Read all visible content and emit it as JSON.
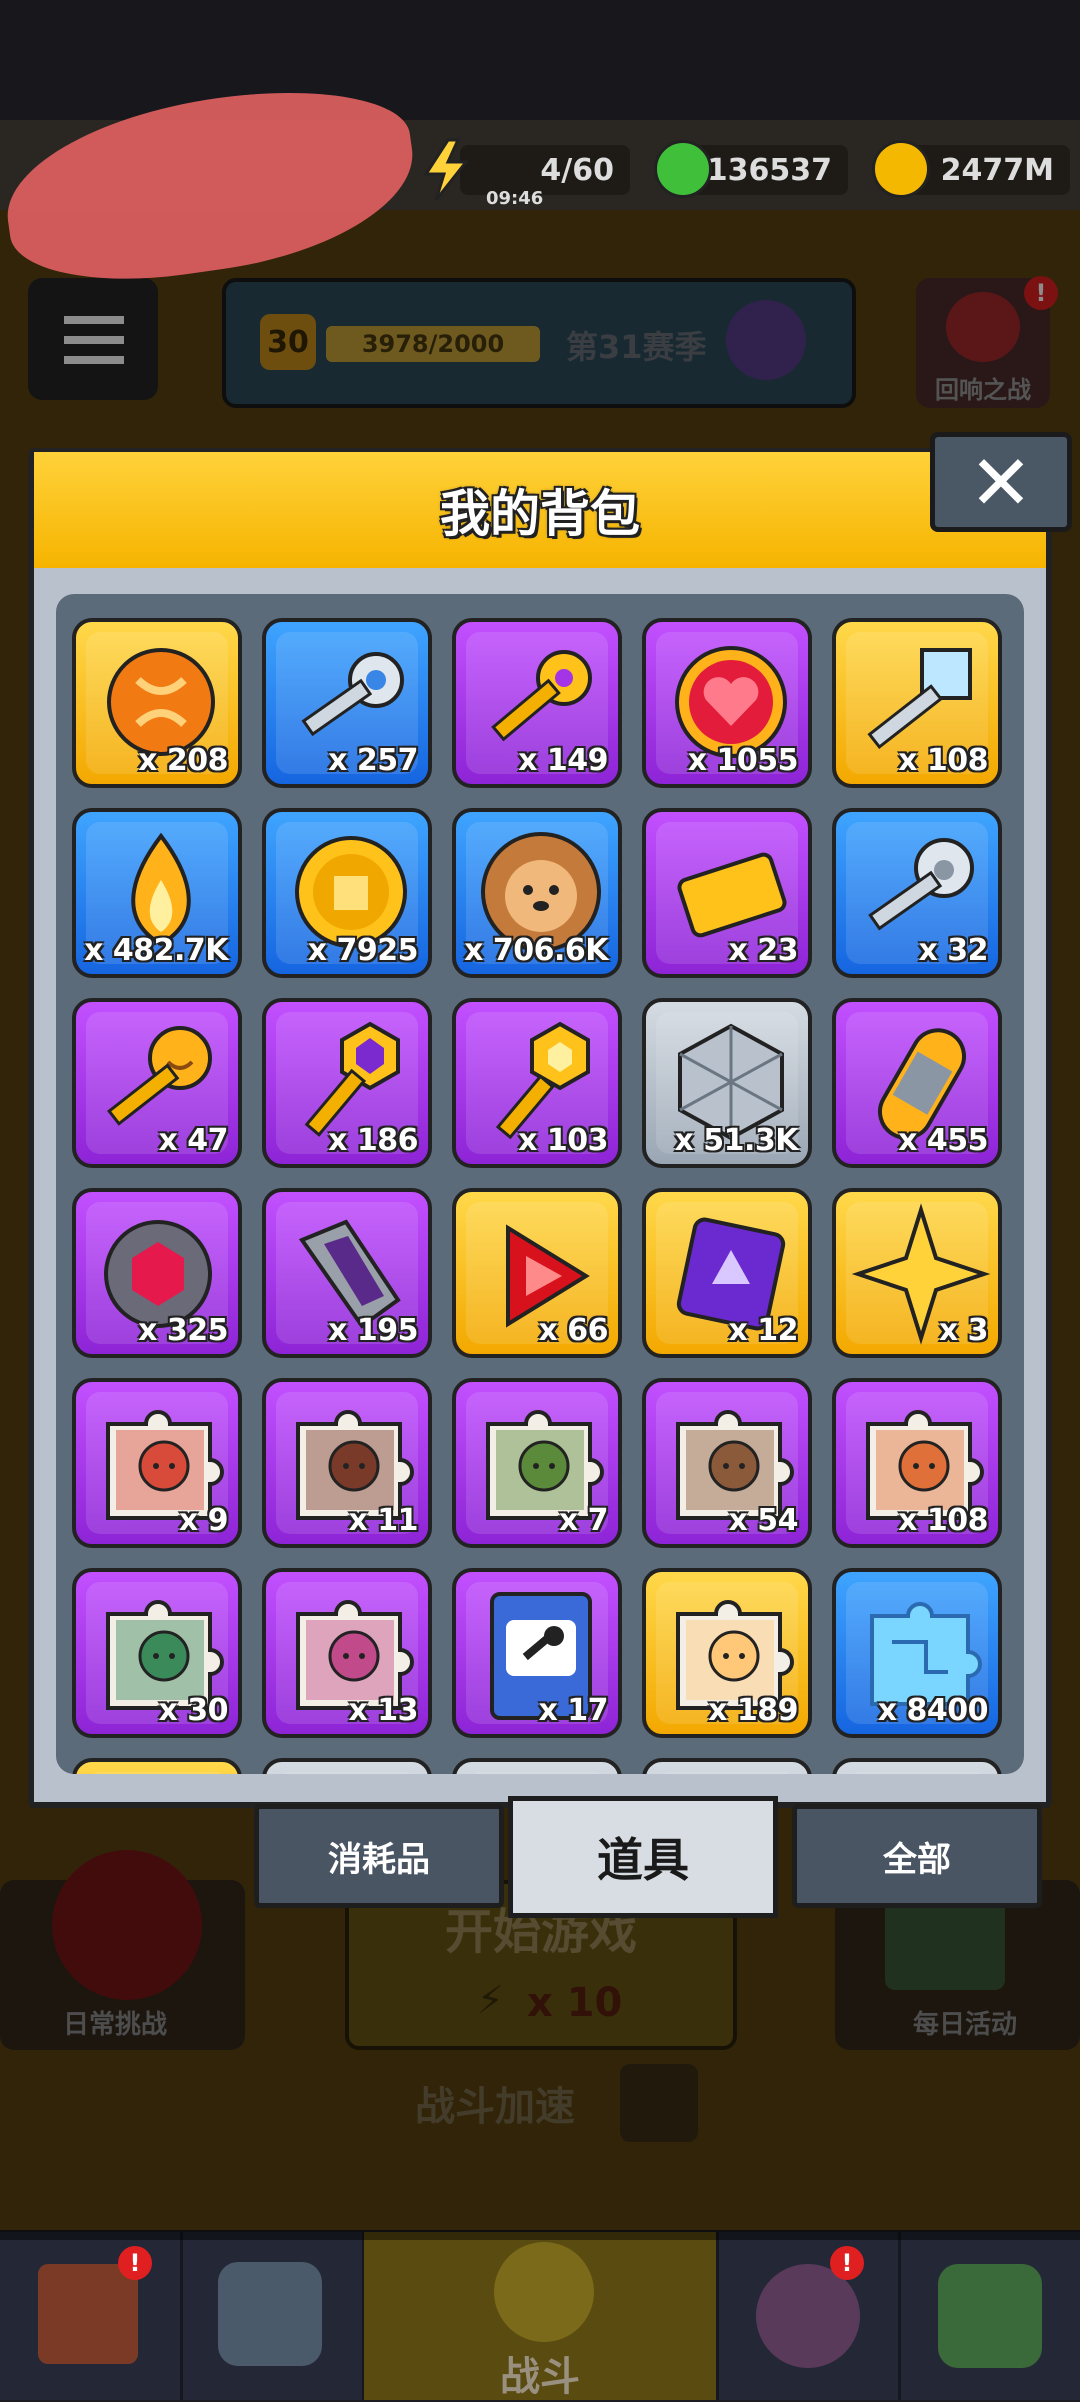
{
  "hud": {
    "energy": "4/60",
    "energy_timer": "09:46",
    "gems": "136537",
    "coins": "2477M"
  },
  "season": {
    "level": "30",
    "xp": "3978/2000",
    "title": "第31赛季"
  },
  "top_right_button": "回响之战",
  "side_left_label": "日常挑战",
  "side_right_label": "每日活动",
  "start_button": {
    "label": "开始游戏",
    "cost": "x 10"
  },
  "speed_label": "战斗加速",
  "nav_center_label": "战斗",
  "modal": {
    "title": "我的背包",
    "close_symbol": "✕",
    "tabs": [
      {
        "label": "消耗品"
      },
      {
        "label": "道具"
      },
      {
        "label": "全部"
      }
    ],
    "items": [
      {
        "icon": "orange-rune-coin-icon",
        "rarity": "gold",
        "count": "x 208"
      },
      {
        "icon": "silver-key-icon",
        "rarity": "blue",
        "count": "x 257"
      },
      {
        "icon": "golden-key-icon",
        "rarity": "purple",
        "count": "x 149"
      },
      {
        "icon": "heart-coin-icon",
        "rarity": "purple",
        "count": "x 1055"
      },
      {
        "icon": "crystal-key-icon",
        "rarity": "gold",
        "count": "x 108"
      },
      {
        "icon": "golden-flame-icon",
        "rarity": "blue",
        "count": "x 482.7K"
      },
      {
        "icon": "gold-coin-icon",
        "rarity": "blue",
        "count": "x 7925"
      },
      {
        "icon": "dog-cookie-icon",
        "rarity": "blue",
        "count": "x 706.6K"
      },
      {
        "icon": "gold-ticket-icon",
        "rarity": "purple",
        "count": "x 23"
      },
      {
        "icon": "paw-key-icon",
        "rarity": "blue",
        "count": "x 32"
      },
      {
        "icon": "smile-key-icon",
        "rarity": "purple",
        "count": "x 47"
      },
      {
        "icon": "hex-gem-key-icon",
        "rarity": "purple",
        "count": "x 186"
      },
      {
        "icon": "hex-key-icon",
        "rarity": "purple",
        "count": "x 103"
      },
      {
        "icon": "metal-cube-icon",
        "rarity": "gray",
        "count": "x 51.3K"
      },
      {
        "icon": "capsule-icon",
        "rarity": "purple",
        "count": "x 455"
      },
      {
        "icon": "red-gem-orb-icon",
        "rarity": "purple",
        "count": "x 325"
      },
      {
        "icon": "crystal-shard-icon",
        "rarity": "purple",
        "count": "x 195"
      },
      {
        "icon": "red-triangle-gem-icon",
        "rarity": "gold",
        "count": "x 66"
      },
      {
        "icon": "purple-chip-icon",
        "rarity": "gold",
        "count": "x 12"
      },
      {
        "icon": "gold-star-icon",
        "rarity": "gold",
        "count": "x 3"
      },
      {
        "icon": "puzzle-hero-1-icon",
        "rarity": "purple",
        "count": "x 9"
      },
      {
        "icon": "puzzle-hero-2-icon",
        "rarity": "purple",
        "count": "x 11"
      },
      {
        "icon": "puzzle-hero-3-icon",
        "rarity": "purple",
        "count": "x 7"
      },
      {
        "icon": "puzzle-hero-4-icon",
        "rarity": "purple",
        "count": "x 54"
      },
      {
        "icon": "puzzle-hero-5-icon",
        "rarity": "purple",
        "count": "x 108"
      },
      {
        "icon": "puzzle-hero-6-icon",
        "rarity": "purple",
        "count": "x 30"
      },
      {
        "icon": "puzzle-hero-7-icon",
        "rarity": "purple",
        "count": "x 13"
      },
      {
        "icon": "mic-book-icon",
        "rarity": "purple",
        "count": "x 17"
      },
      {
        "icon": "puzzle-hero-s-icon",
        "rarity": "gold",
        "count": "x 189"
      },
      {
        "icon": "circuit-puzzle-icon",
        "rarity": "blue",
        "count": "x 8400"
      }
    ]
  },
  "colors": {
    "gold": "#f6b400",
    "blue": "#1f78ef",
    "purple": "#a435e6",
    "gray": "#aeb7c2",
    "panel": "#5c6b7a",
    "header": "#ffd23a"
  }
}
